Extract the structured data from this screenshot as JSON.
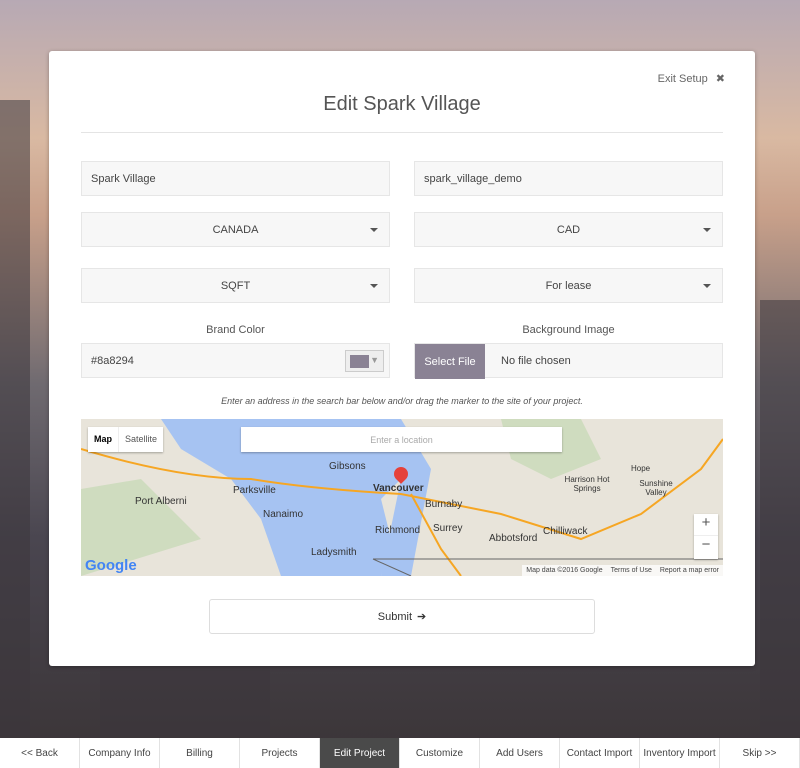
{
  "header": {
    "exit_label": "Exit Setup",
    "title": "Edit Spark Village"
  },
  "form": {
    "project_name": "Spark Village",
    "slug": "spark_village_demo",
    "country": "CANADA",
    "currency": "CAD",
    "unit": "SQFT",
    "listing_type": "For lease",
    "brand_color_label": "Brand Color",
    "brand_color": "#8a8294",
    "background_image_label": "Background Image",
    "select_file": "Select File",
    "file_status": "No file chosen",
    "hint": "Enter an address in the search bar below and/or drag the marker to the site of your project.",
    "submit": "Submit"
  },
  "map": {
    "type_map": "Map",
    "type_satellite": "Satellite",
    "search_placeholder": "Enter a location",
    "labels": [
      "Gibsons",
      "Vancouver",
      "Burnaby",
      "Parksville",
      "Port Alberni",
      "Nanaimo",
      "Richmond",
      "Surrey",
      "Abbotsford",
      "Chilliwack",
      "Ladysmith",
      "Harrison Hot Springs",
      "Hope",
      "Sunshine Valley"
    ],
    "zoom_in": "+",
    "zoom_out": "−",
    "logo": "Google",
    "attribution": "Map data ©2016 Google",
    "terms": "Terms of Use",
    "report": "Report a map error"
  },
  "nav": {
    "items": [
      "<< Back",
      "Company Info",
      "Billing",
      "Projects",
      "Edit Project",
      "Customize",
      "Add Users",
      "Contact Import",
      "Inventory Import",
      "Skip >>"
    ],
    "active": "Edit Project"
  }
}
